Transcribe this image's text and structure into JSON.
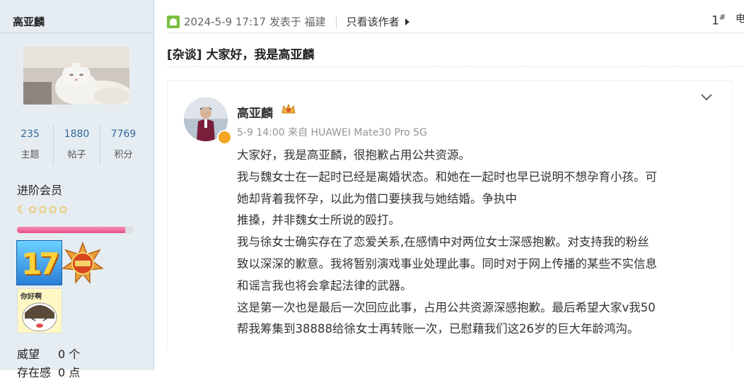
{
  "sidebar": {
    "username": "高亚麟",
    "stats": [
      {
        "value": "235",
        "label": "主题"
      },
      {
        "value": "1880",
        "label": "帖子"
      },
      {
        "value": "7769",
        "label": "积分"
      }
    ],
    "rank": "进阶会员",
    "progress": 0.93,
    "medal_17": "17",
    "medal_face_text": "你好啊",
    "weiwang_label": "威望",
    "weiwang_value": "0 个",
    "cunzai_label": "存在感",
    "cunzai_value": "0 点"
  },
  "post": {
    "meta": "2024-5-9 17:17 发表于 福建",
    "only_author": "只看该作者",
    "floor": "1",
    "floor_sup": "#",
    "edge_text": "电",
    "title": "[杂谈] 大家好，我是高亚麟"
  },
  "weibo": {
    "name": "高亚麟",
    "meta": "5-9 14:00 来自 HUAWEI Mate30 Pro 5G",
    "lines": [
      "大家好，我是高亚麟，很抱歉占用公共资源。",
      "我与魏女士在一起时已经是离婚状态。和她在一起时也早已说明不想孕育小孩。可",
      "她却背着我怀孕，以此为借口要挟我与她结婚。争执中",
      "推搡，并非魏女士所说的殴打。",
      "我与徐女士确实存在了恋爱关系,在感情中对两位女士深感抱歉。对支持我的粉丝",
      "致以深深的歉意。我将暂别演戏事业处理此事。同时对于网上传播的某些不实信息",
      "和谣言我也将会拿起法律的武器。",
      "这是第一次也是最后一次回应此事，占用公共资源深感抱歉。最后希望大家v我50",
      "帮我筹集到38888给徐女士再转账一次，已慰藉我们这26岁的巨大年龄鸿沟。"
    ]
  }
}
